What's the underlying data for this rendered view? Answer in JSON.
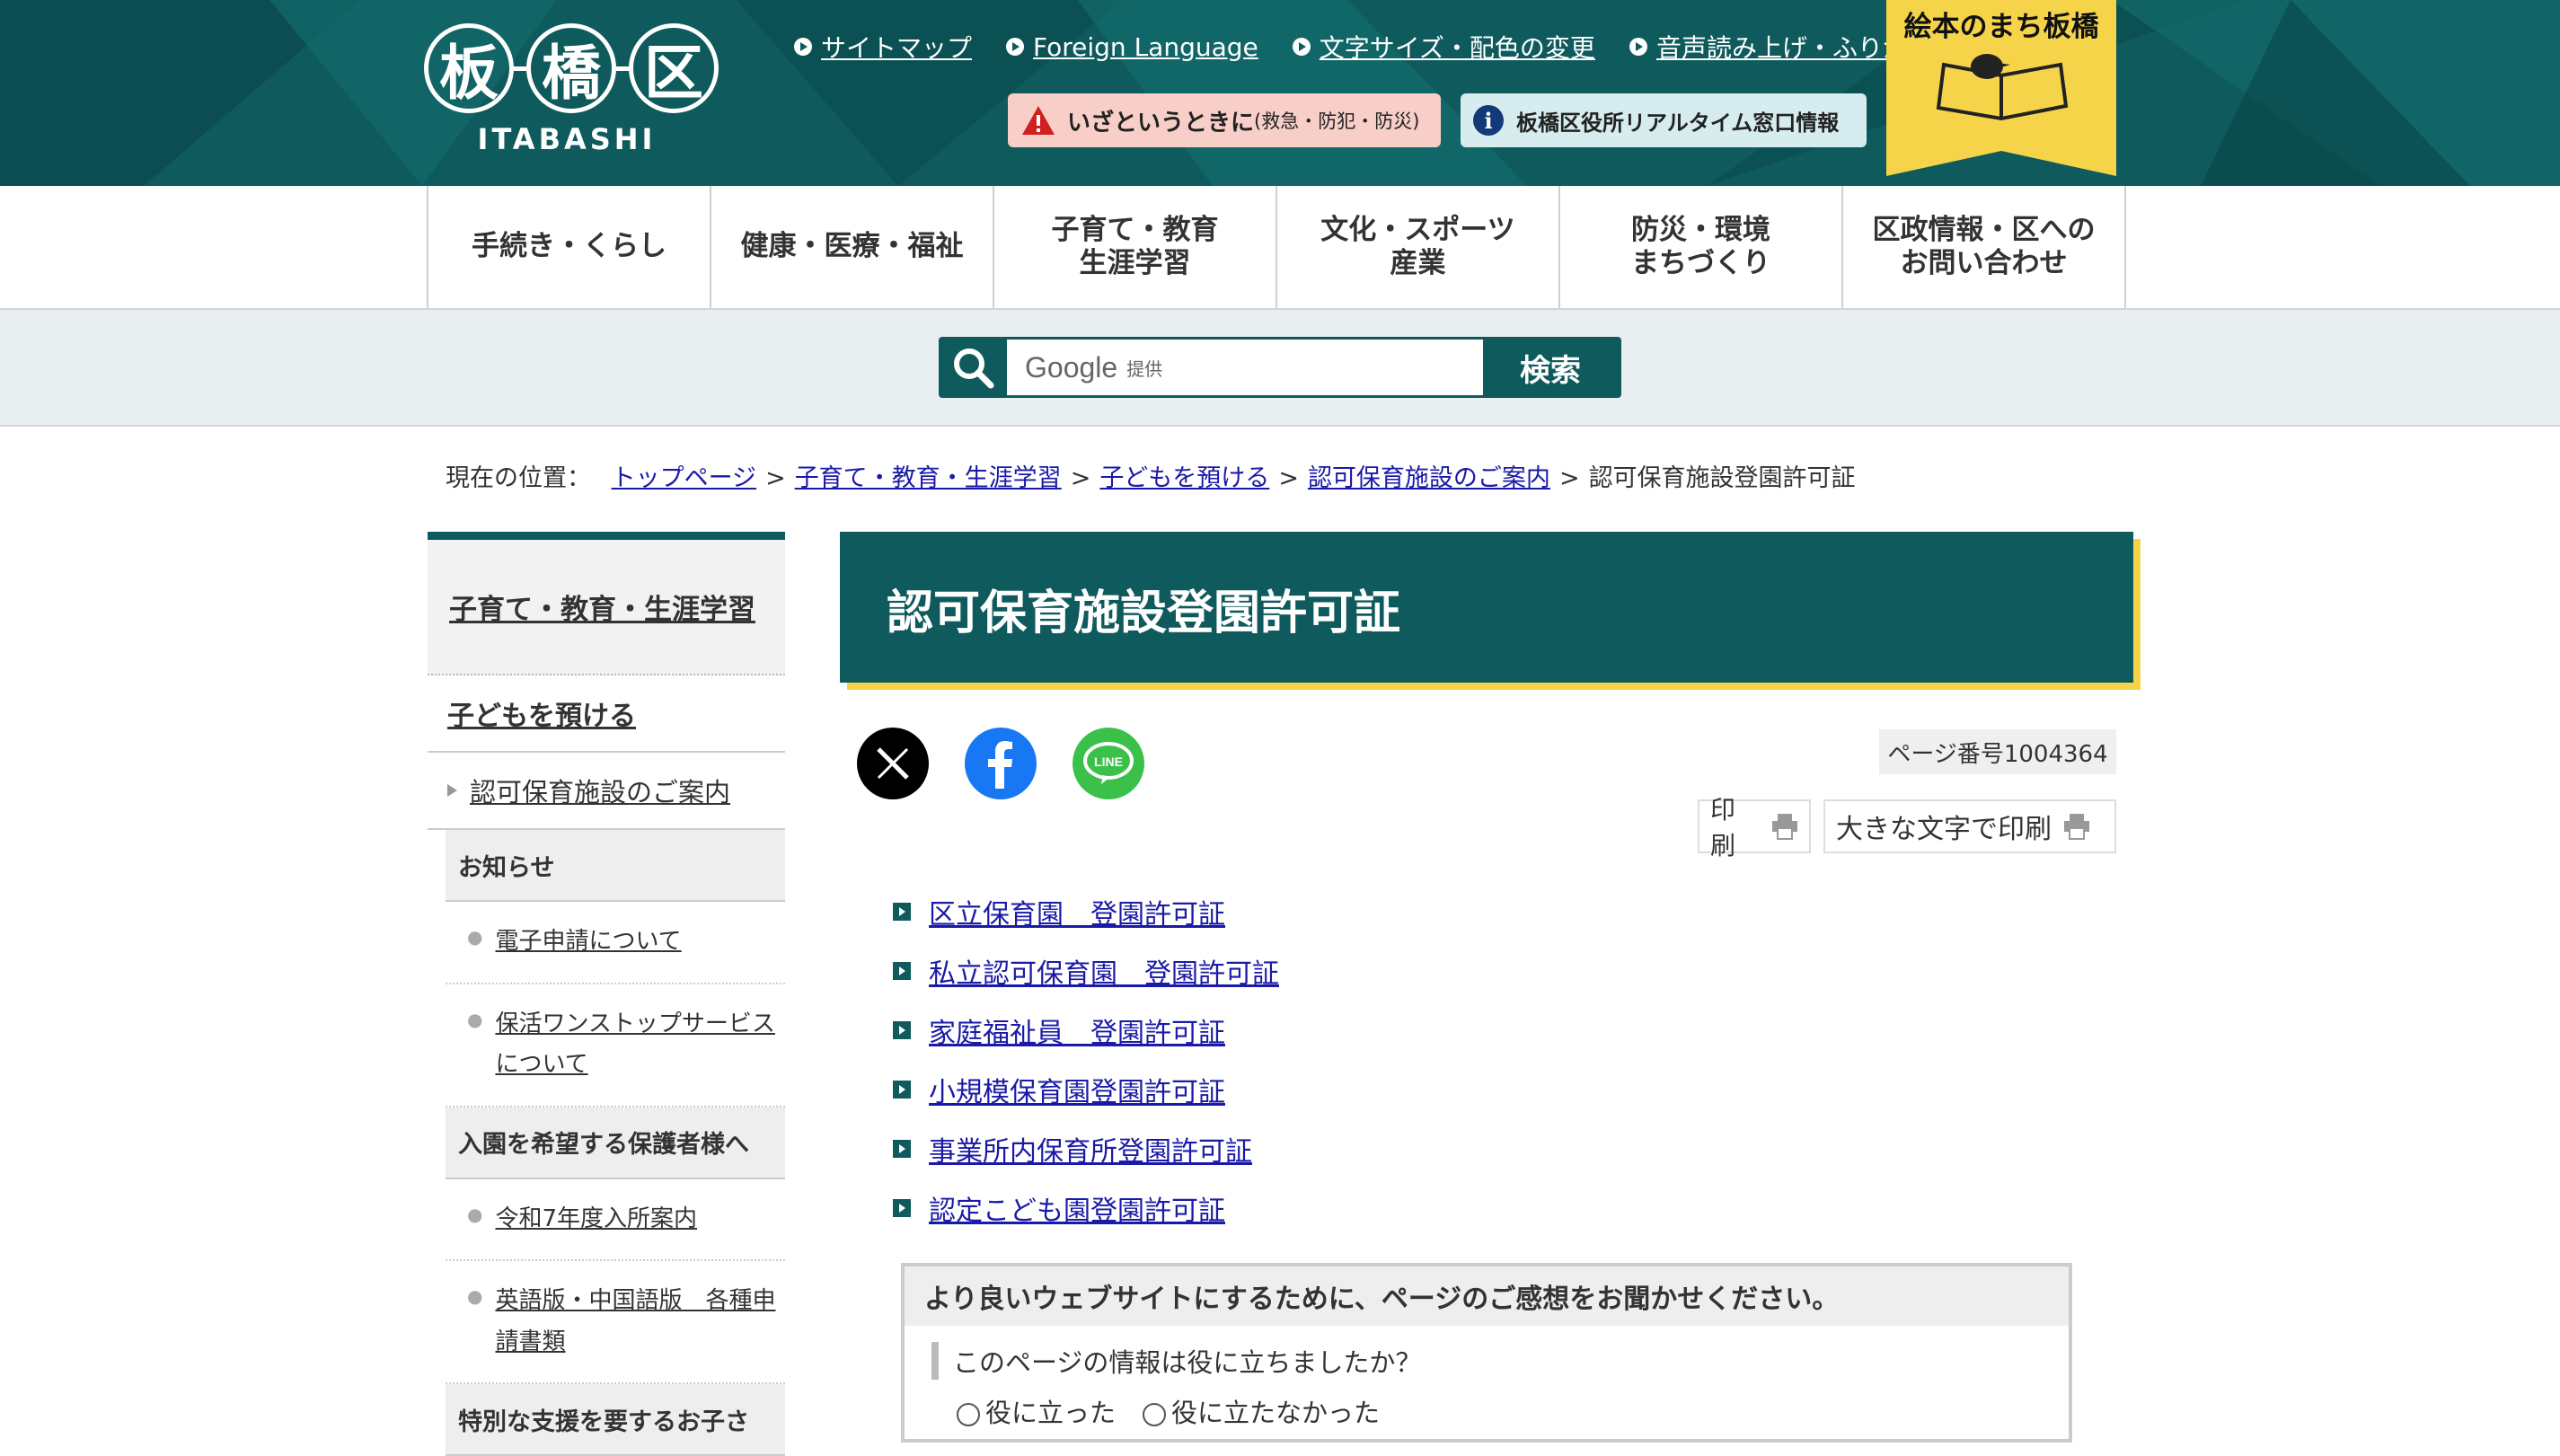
{
  "header": {
    "logo_chars": [
      "板",
      "橋",
      "区"
    ],
    "logo_romaji": "ITABASHI",
    "util_links": [
      "サイトマップ",
      "Foreign Language",
      "文字サイズ・配色の変更",
      "音声読み上げ・ふりがな"
    ],
    "emergency_label": "いざというときに",
    "emergency_sub": "(救急・防犯・防災)",
    "realtime_label": "板橋区役所リアルタイム窓口情報",
    "ehon_label": "絵本のまち板橋",
    "colors": {
      "brand": "#0e5a5c",
      "accent": "#f5d44a",
      "emergency_bg": "#f8cfc8"
    }
  },
  "gnav": [
    "手続き・くらし",
    "健康・医療・福祉",
    "子育て・教育\n生涯学習",
    "文化・スポーツ\n産業",
    "防災・環境\nまちづくり",
    "区政情報・区への\nお問い合わせ"
  ],
  "search": {
    "google": "Google",
    "provider": "提供",
    "button": "検索"
  },
  "breadcrumb": {
    "prefix": "現在の位置：",
    "links": [
      "トップページ",
      "子育て・教育・生涯学習",
      "子どもを預ける",
      "認可保育施設のご案内"
    ],
    "current": "認可保育施設登園許可証",
    "separator": ">"
  },
  "sidebar": {
    "top": "子育て・教育・生涯学習",
    "level1": "子どもを預ける",
    "level2": "認可保育施設のご案内",
    "groups": [
      {
        "title": "お知らせ",
        "items": [
          "電子申請について",
          "保活ワンストップサービスについて"
        ]
      },
      {
        "title": "入園を希望する保護者様へ",
        "items": [
          "令和7年度入所案内",
          "英語版・中国語版　各種申請書類"
        ]
      },
      {
        "title": "特別な支援を要するお子さ",
        "items": []
      }
    ]
  },
  "main": {
    "title": "認可保育施設登園許可証",
    "page_number": "ページ番号1004364",
    "print": "印刷",
    "print_large": "大きな文字で印刷",
    "links": [
      "区立保育園　登園許可証",
      "私立認可保育園　登園許可証",
      "家庭福祉員　登園許可証",
      "小規模保育園登園許可証",
      "事業所内保育所登園許可証",
      "認定こども園登園許可証"
    ]
  },
  "feedback": {
    "heading": "より良いウェブサイトにするために、ページのご感想をお聞かせください。",
    "question": "このページの情報は役に立ちましたか？",
    "options": [
      "役に立った",
      "役に立たなかった"
    ]
  }
}
